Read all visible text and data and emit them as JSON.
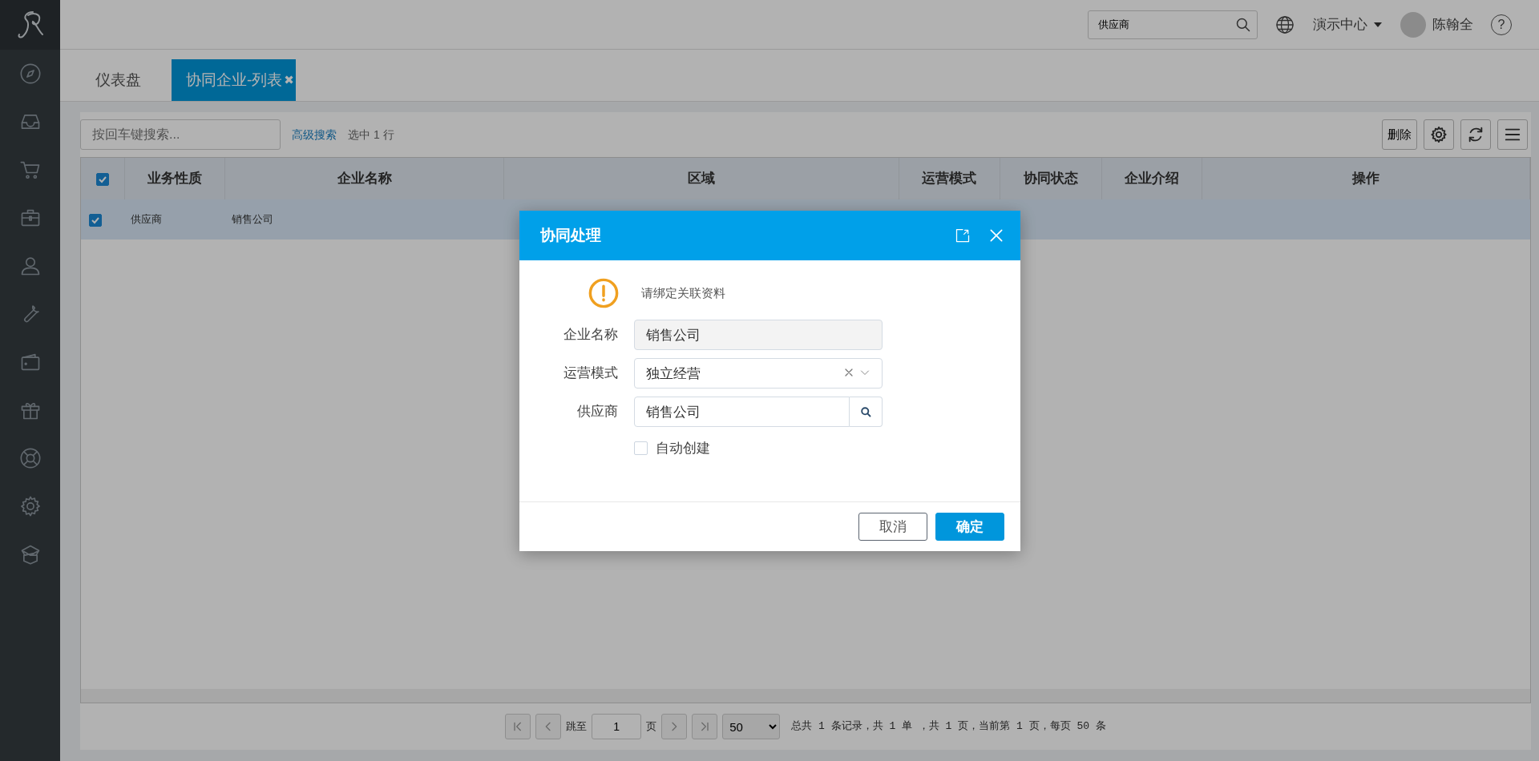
{
  "top_bar": {
    "search": {
      "value": "供应商"
    },
    "org_menu": {
      "label": "演示中心"
    },
    "user": {
      "name": "陈翰全"
    },
    "help": "?"
  },
  "tabs": [
    {
      "label": "仪表盘",
      "selected": false
    },
    {
      "label": "协同企业-列表",
      "selected": true,
      "close": "✖"
    }
  ],
  "toolbar": {
    "search": {
      "placeholder": "按回车键搜索..."
    },
    "advanced_link": "高级搜索",
    "selection_info": "选中 1 行",
    "delete_button": "删除"
  },
  "table": {
    "all_checked": true,
    "columns": [
      "业务性质",
      "企业名称",
      "区域",
      "运营模式",
      "协同状态",
      "企业介绍",
      "操作"
    ],
    "rows": [
      {
        "checked": true,
        "selected": true,
        "cells": [
          "供应商",
          "销售公司",
          "",
          "",
          "",
          "",
          ""
        ]
      }
    ]
  },
  "pagination": {
    "jump_label": "跳至",
    "page": "1",
    "page_unit": "页",
    "page_size": "50",
    "summary": "总共 1 条记录，共 1 单 ，共 1 页，当前第 1 页，每页 50 条"
  },
  "dialog": {
    "title": "协同处理",
    "notice": "请绑定关联资料",
    "fields": [
      {
        "kind": "readonly",
        "label": "企业名称",
        "value": "销售公司"
      },
      {
        "kind": "select",
        "label": "运营模式",
        "value": "独立经营"
      },
      {
        "kind": "lookup",
        "label": "供应商",
        "value": "销售公司"
      }
    ],
    "auto_create": {
      "label": "自动创建",
      "checked": false
    },
    "buttons": [
      {
        "kind": "secondary",
        "label": "取消"
      },
      {
        "kind": "primary",
        "label": "确定"
      }
    ]
  }
}
